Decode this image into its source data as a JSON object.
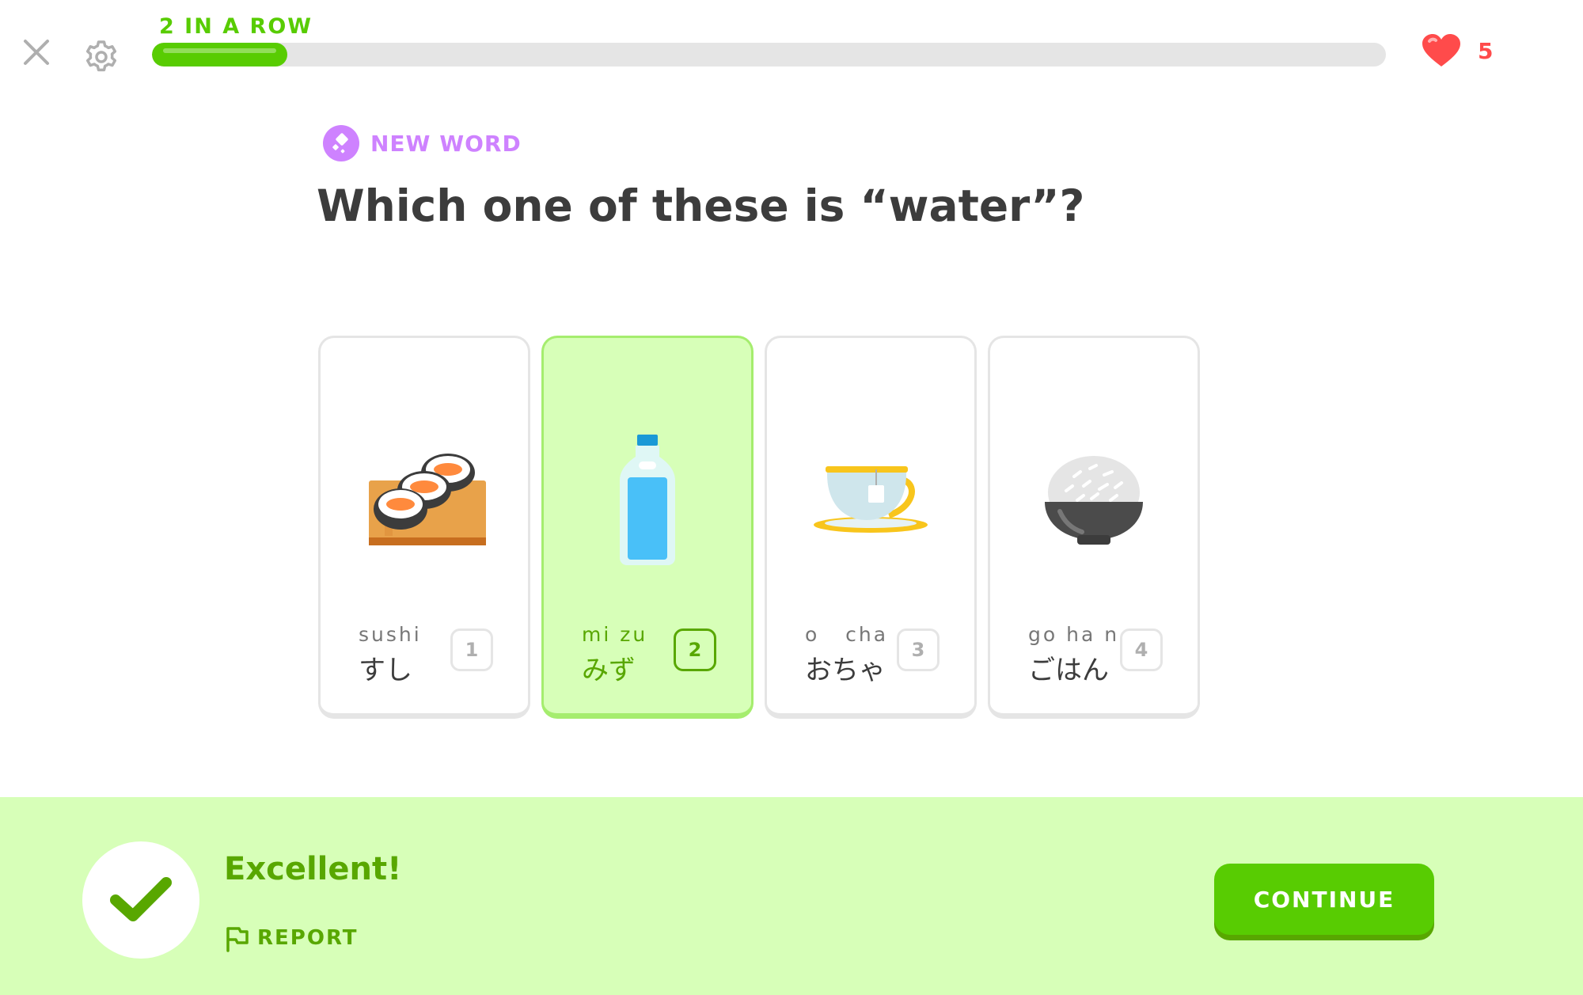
{
  "header": {
    "streak_label": "2 IN A ROW",
    "progress_percent": 11,
    "hearts_count": "5"
  },
  "question": {
    "tag_label": "NEW WORD",
    "prompt": "Which one of these is “water”?"
  },
  "choices": [
    {
      "romaji": "sushi",
      "kana": "すし",
      "key": "1",
      "image": "sushi-icon",
      "selected": false
    },
    {
      "romaji": "mi zu",
      "kana": "みず",
      "key": "2",
      "image": "water-bottle-icon",
      "selected": true
    },
    {
      "romaji": "o   cha",
      "kana": "おちゃ",
      "key": "3",
      "image": "tea-cup-icon",
      "selected": false
    },
    {
      "romaji": "go ha n",
      "kana": "ごはん",
      "key": "4",
      "image": "rice-bowl-icon",
      "selected": false
    }
  ],
  "feedback": {
    "title": "Excellent!",
    "report_label": "REPORT",
    "continue_label": "CONTINUE"
  },
  "colors": {
    "accent_green": "#58cc02",
    "dark_green": "#58a700",
    "light_green": "#d7ffb8",
    "heart_red": "#ff4b4b",
    "new_word_purple": "#ce82ff"
  }
}
